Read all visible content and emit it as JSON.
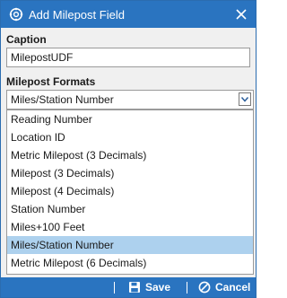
{
  "window": {
    "title": "Add Milepost Field"
  },
  "caption": {
    "label": "Caption",
    "value": "MilepostUDF"
  },
  "formats": {
    "label": "Milepost Formats",
    "selected": "Miles/Station Number",
    "options": [
      "Reading Number",
      "Location ID",
      "Metric Milepost (3 Decimals)",
      "Milepost (3 Decimals)",
      "Milepost (4 Decimals)",
      "Station Number",
      "Miles+100 Feet",
      "Miles/Station Number",
      "Metric Milepost (6 Decimals)"
    ],
    "highlighted_index": 7
  },
  "footer": {
    "save_label": "Save",
    "cancel_label": "Cancel"
  },
  "colors": {
    "titlebar": "#2a74c0",
    "footer": "#2a74c0",
    "selection": "#add1ee"
  },
  "icons": {
    "app": "settings-gear-icon",
    "close": "close-icon",
    "dropdown": "chevron-down-icon",
    "save": "floppy-disk-icon",
    "cancel": "cancel-circle-icon"
  }
}
